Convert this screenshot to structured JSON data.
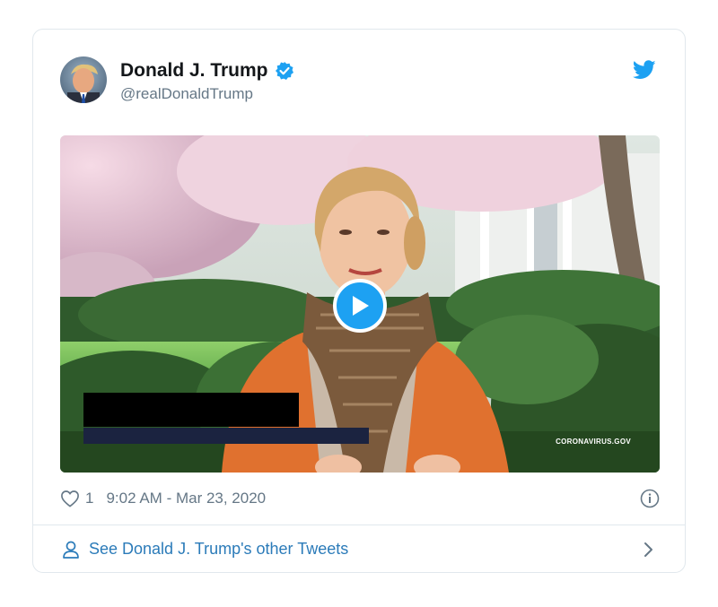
{
  "tweet": {
    "author_name": "Donald J. Trump",
    "handle": "@realDonaldTrump",
    "verified": true,
    "like_count": "1",
    "timestamp": "9:02 AM - Mar 23, 2020",
    "media": {
      "watermark": "CORONAVIRUS.GOV"
    },
    "footer_link": "See Donald J. Trump's other Tweets"
  },
  "colors": {
    "brand_blue": "#1da1f2",
    "link_blue": "#2b7bb9",
    "muted_gray": "#657786",
    "border": "#e1e8ed"
  },
  "icons": [
    "verified-badge-icon",
    "twitter-bird-icon",
    "play-icon",
    "heart-icon",
    "info-icon",
    "person-icon",
    "chevron-right-icon"
  ]
}
